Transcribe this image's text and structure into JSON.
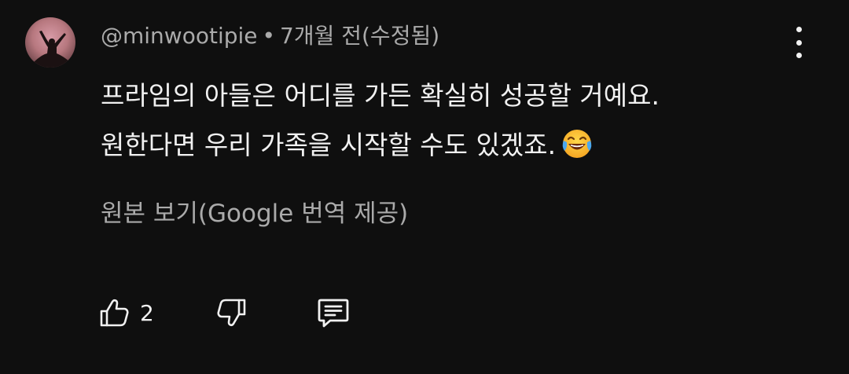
{
  "comment": {
    "author": "@minwootipie",
    "separator": "•",
    "time": "7개월 전(수정됨)",
    "body_lines": [
      "프라임의 아들은 어디를 가든 확실히 성공할 거예요.",
      "원한다면 우리 가족을 시작할 수도 있겠죠."
    ],
    "emoji": "face-with-tears-of-joy",
    "translate_label": "원본 보기(Google 번역 제공)",
    "like_count": "2"
  },
  "icons": {
    "more": "more-vertical-icon",
    "like": "thumbs-up-icon",
    "dislike": "thumbs-down-icon",
    "reply": "reply-comment-icon"
  },
  "colors": {
    "background": "#0f0f0f",
    "text_primary": "#f1f1f1",
    "text_secondary": "#aaaaaa"
  }
}
